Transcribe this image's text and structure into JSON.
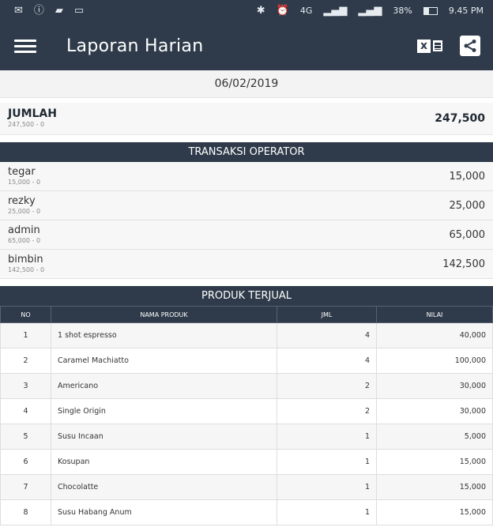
{
  "status_bar": {
    "left_icons": [
      "mail-icon",
      "info-icon",
      "chat-icon",
      "message-icon"
    ],
    "network": "4G",
    "battery": "38%",
    "battery_level": 0.38,
    "time": "9.45 PM"
  },
  "app_bar": {
    "title": "Laporan Harian"
  },
  "report": {
    "date": "06/02/2019",
    "total": {
      "label": "JUMLAH",
      "sub": "247,500 - 0",
      "value": "247,500"
    },
    "operator_section_title": "TRANSAKSI OPERATOR",
    "operators": [
      {
        "name": "tegar",
        "sub": "15,000 - 0",
        "value": "15,000"
      },
      {
        "name": "rezky",
        "sub": "25,000 - 0",
        "value": "25,000"
      },
      {
        "name": "admin",
        "sub": "65,000 - 0",
        "value": "65,000"
      },
      {
        "name": "bimbin",
        "sub": "142,500 - 0",
        "value": "142,500"
      }
    ],
    "products_section_title": "PRODUK TERJUAL",
    "product_columns": {
      "no": "NO",
      "name": "NAMA PRODUK",
      "qty": "JML",
      "value": "NILAI"
    },
    "products": [
      {
        "no": "1",
        "name": "1 shot espresso",
        "qty": "4",
        "value": "40,000"
      },
      {
        "no": "2",
        "name": "Caramel Machiatto",
        "qty": "4",
        "value": "100,000"
      },
      {
        "no": "3",
        "name": "Americano",
        "qty": "2",
        "value": "30,000"
      },
      {
        "no": "4",
        "name": "Single Origin",
        "qty": "2",
        "value": "30,000"
      },
      {
        "no": "5",
        "name": "Susu Incaan",
        "qty": "1",
        "value": "5,000"
      },
      {
        "no": "6",
        "name": "Kosupan",
        "qty": "1",
        "value": "15,000"
      },
      {
        "no": "7",
        "name": "Chocolatte",
        "qty": "1",
        "value": "15,000"
      },
      {
        "no": "8",
        "name": "Susu Habang Anum",
        "qty": "1",
        "value": "15,000"
      }
    ]
  },
  "colors": {
    "primary": "#2f3b4a",
    "row_alt": "#f6f6f6",
    "number_accent": "#3a6ea5"
  }
}
